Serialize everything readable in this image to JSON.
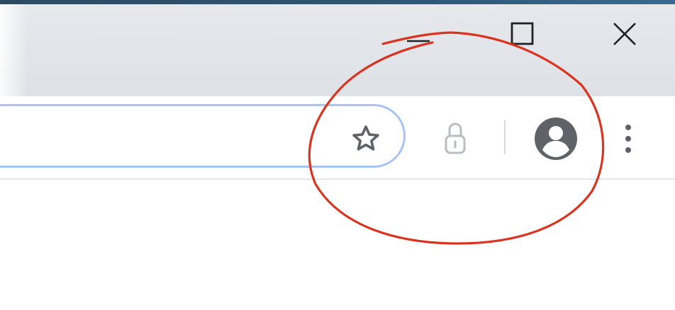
{
  "window_controls": {
    "minimize_icon": "minimize-icon",
    "maximize_icon": "maximize-icon",
    "close_icon": "close-icon"
  },
  "omnibox": {
    "value": "",
    "placeholder": ""
  },
  "toolbar": {
    "bookmark_icon": "star-outline-icon",
    "lock_icon": "padlock-icon",
    "profile_icon": "account-circle-icon",
    "menu_icon": "vertical-ellipsis-icon"
  },
  "colors": {
    "titlebar": "#dee1e6",
    "omnibox_border": "#a9c4f2",
    "icon_dark": "#5f6368",
    "icon_disabled": "#b9bcc0",
    "annotation": "#d93420"
  }
}
